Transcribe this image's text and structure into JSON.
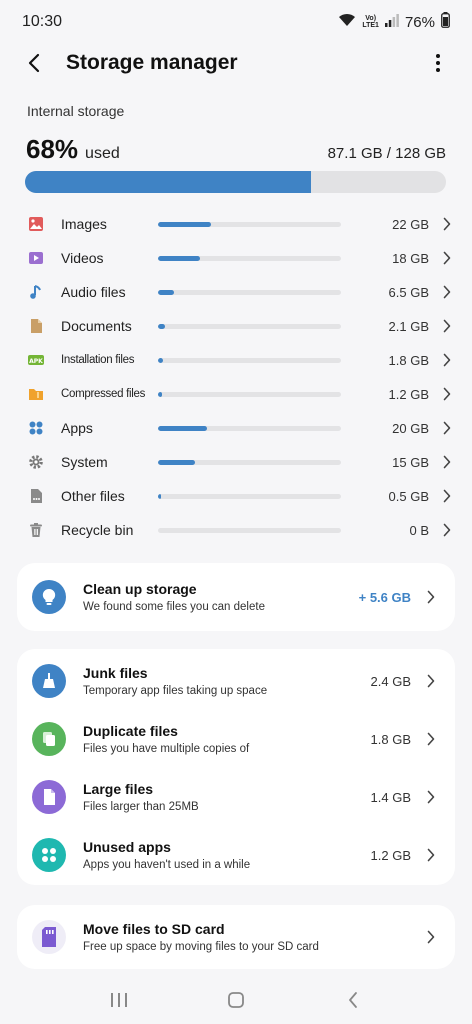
{
  "status": {
    "time": "10:30",
    "network_top": "Vo)",
    "network_bottom": "LTE1",
    "battery": "76%"
  },
  "header": {
    "title": "Storage manager"
  },
  "storage": {
    "section_label": "Internal storage",
    "used_percent": "68%",
    "used_word": "used",
    "used_amount": "87.1 GB / 128 GB",
    "used_fraction": 0.68
  },
  "categories": [
    {
      "label": "Images",
      "size": "22 GB",
      "fraction": 0.29,
      "icon": "image-icon",
      "color": "#e15b5b"
    },
    {
      "label": "Videos",
      "size": "18 GB",
      "fraction": 0.23,
      "icon": "video-icon",
      "color": "#9b6fd0"
    },
    {
      "label": "Audio files",
      "size": "6.5 GB",
      "fraction": 0.09,
      "icon": "music-note-icon",
      "color": "#3f83c5"
    },
    {
      "label": "Documents",
      "size": "2.1 GB",
      "fraction": 0.04,
      "icon": "document-icon",
      "color": "#c99f67"
    },
    {
      "label": "Installation files",
      "size": "1.8 GB",
      "fraction": 0.03,
      "icon": "apk-icon",
      "color": "#74b536"
    },
    {
      "label": "Compressed files",
      "size": "1.2 GB",
      "fraction": 0.02,
      "icon": "folder-zip-icon",
      "color": "#f0a22c"
    },
    {
      "label": "Apps",
      "size": "20 GB",
      "fraction": 0.27,
      "icon": "apps-grid-icon",
      "color": "#3f83c5"
    },
    {
      "label": "System",
      "size": "15 GB",
      "fraction": 0.2,
      "icon": "gear-icon",
      "color": "#777777"
    },
    {
      "label": "Other files",
      "size": "0.5 GB",
      "fraction": 0.01,
      "icon": "more-file-icon",
      "color": "#8a8a8a"
    },
    {
      "label": "Recycle bin",
      "size": "0 B",
      "fraction": 0,
      "icon": "trash-icon",
      "color": "#8a8a8a"
    }
  ],
  "cleanup": {
    "title": "Clean up storage",
    "subtitle": "We found some files you can delete",
    "value": "+ 5.6 GB",
    "icon_color": "#3f83c5"
  },
  "suggestions": [
    {
      "title": "Junk files",
      "subtitle": "Temporary app files taking up space",
      "value": "2.4 GB",
      "icon": "broom-icon",
      "color": "#3f83c5"
    },
    {
      "title": "Duplicate files",
      "subtitle": "Files you have multiple copies of",
      "value": "1.8 GB",
      "icon": "copy-icon",
      "color": "#58b45c"
    },
    {
      "title": "Large files",
      "subtitle": "Files larger than 25MB",
      "value": "1.4 GB",
      "icon": "large-file-icon",
      "color": "#8c6ad6"
    },
    {
      "title": "Unused apps",
      "subtitle": "Apps you haven't used in a while",
      "value": "1.2 GB",
      "icon": "apps-icon",
      "color": "#1fb8b0"
    }
  ],
  "sdcard": {
    "title": "Move files to SD card",
    "subtitle": "Free up space by moving files to your SD card",
    "icon_color": "#7b5ad1"
  }
}
